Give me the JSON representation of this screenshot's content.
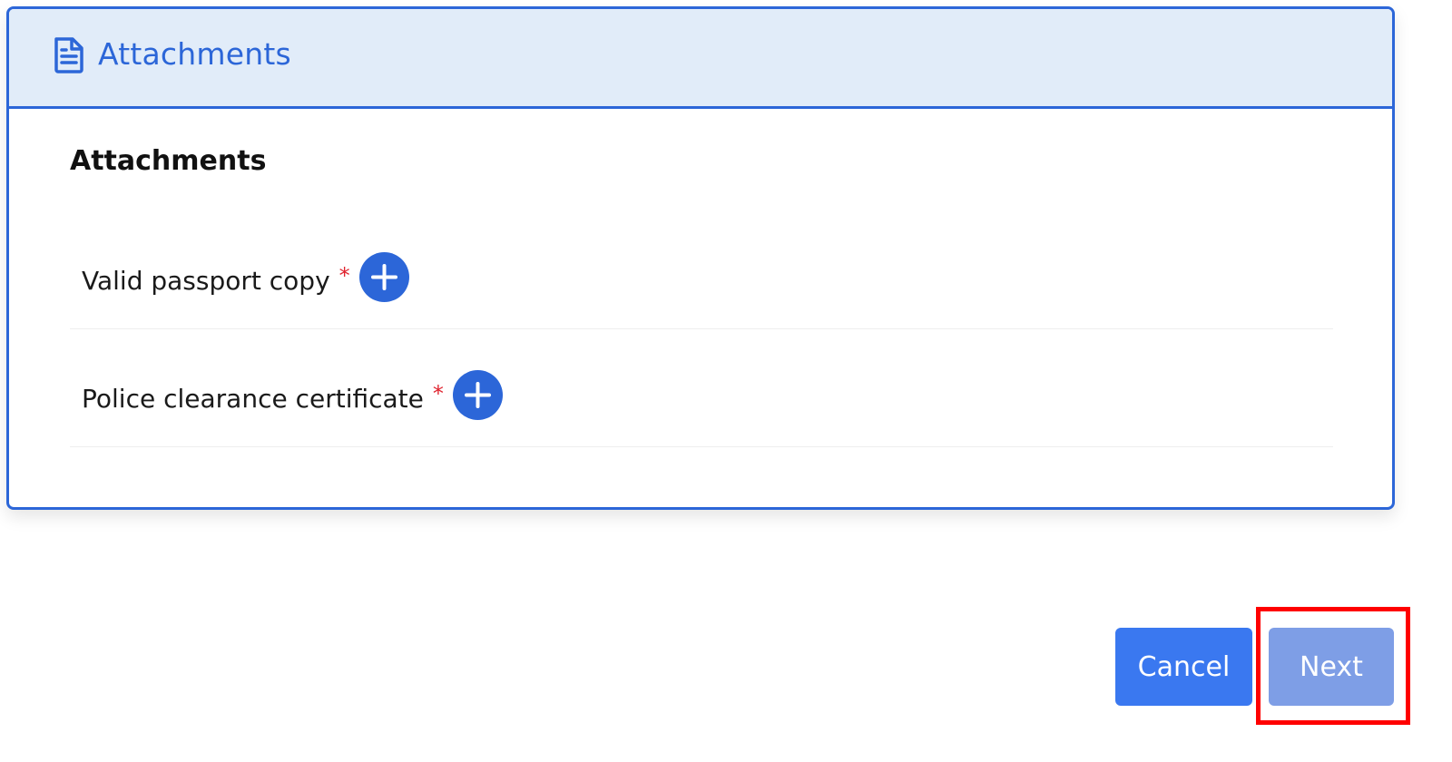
{
  "header": {
    "title": "Attachments",
    "icon": "document-icon"
  },
  "section": {
    "title": "Attachments"
  },
  "attachments": [
    {
      "label": "Valid passport copy",
      "required_marker": "*",
      "action_icon": "plus-circle-icon"
    },
    {
      "label": "Police clearance certificate",
      "required_marker": "*",
      "action_icon": "plus-circle-icon"
    }
  ],
  "actions": {
    "cancel_label": "Cancel",
    "next_label": "Next"
  },
  "colors": {
    "accent": "#2c66d8",
    "header_bg": "#e1ecf9",
    "required": "#e0242f",
    "cancel_bg": "#3a78f0",
    "next_bg_disabled": "#7e9ee6",
    "highlight": "#ff0000"
  }
}
